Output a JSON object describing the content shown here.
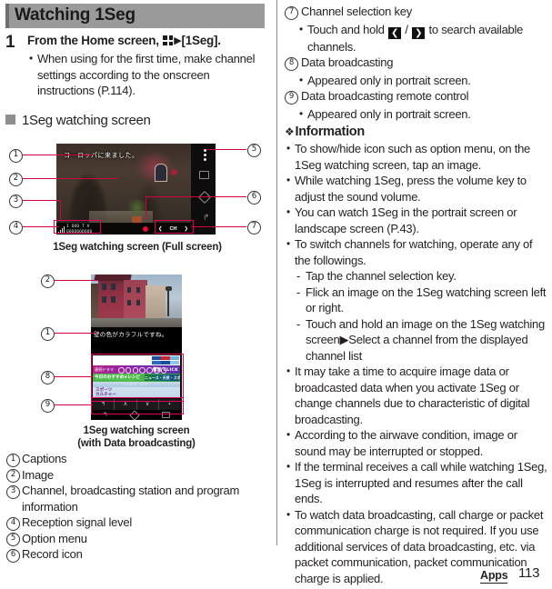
{
  "header": {
    "title": "Watching 1Seg"
  },
  "step": {
    "number": "1",
    "title_pre": "From the Home screen, ",
    "title_post": "[1Seg].",
    "bullets": [
      "When using for the first time, make channel settings according to the onscreen instructions (P.114)."
    ]
  },
  "subsection": {
    "title": "1Seg watching screen"
  },
  "figure_landscape": {
    "caption": "1Seg watching screen (Full screen)",
    "screen_caption_text": "ヨーロッパに来ました。",
    "channel_info_line1": "1 OOO T V",
    "channel_info_line2": "OOOOOOOOOO",
    "ch_label": "CH",
    "prev_arrow": "❮",
    "next_arrow": "❯",
    "callouts": [
      "1",
      "2",
      "3",
      "4",
      "5",
      "6",
      "7"
    ]
  },
  "figure_portrait": {
    "caption_line1": "1Seg watching screen",
    "caption_line2": "(with Data broadcasting)",
    "screen_caption_text": "壁の色がカラフルですね。",
    "data_row1_text": "連続ドラマ",
    "data_row1_right": "電話 CLICK",
    "data_row2_text": "今日のおすすめ★レシピ",
    "data_row2_tag": "ニュース・天気・スポーツ",
    "data_row3_text": "LINE UP",
    "data_list": [
      "スポーツ",
      "カルチャー"
    ],
    "remote_keys": [
      "↰",
      "∧",
      "∨",
      "▪"
    ],
    "callouts": [
      "1",
      "2",
      "8",
      "9"
    ]
  },
  "legend_left": [
    {
      "num": "1",
      "text": "Captions"
    },
    {
      "num": "2",
      "text": "Image"
    },
    {
      "num": "3",
      "text": "Channel, broadcasting station and program information"
    },
    {
      "num": "4",
      "text": "Reception signal level"
    },
    {
      "num": "5",
      "text": "Option menu"
    },
    {
      "num": "6",
      "text": "Record icon"
    }
  ],
  "legend_right": [
    {
      "num": "7",
      "text": "Channel selection key",
      "sub_pre": "Touch and hold ",
      "sub_key1": "❮",
      "sub_mid": " / ",
      "sub_key2": "❯",
      "sub_post": " to search available channels."
    },
    {
      "num": "8",
      "text": "Data broadcasting",
      "sub_plain": "Appeared only in portrait screen."
    },
    {
      "num": "9",
      "text": "Data broadcasting remote control",
      "sub_plain": "Appeared only in portrait screen."
    }
  ],
  "information": {
    "heading": "Information",
    "bullets": [
      {
        "text": "To show/hide icon such as option menu, on the 1Seg watching screen, tap an image."
      },
      {
        "text": "While watching 1Seg, press the volume key to adjust the sound volume."
      },
      {
        "text": "You can watch 1Seg in the portrait screen or landscape screen (P.43)."
      },
      {
        "text": "To switch channels for watching, operate any of the followings.",
        "dashes": [
          "Tap the channel selection key.",
          "Flick an image on the 1Seg watching screen left or right.",
          "Touch and hold an image on the 1Seg watching screen▶Select a channel from the displayed channel list"
        ]
      },
      {
        "text": "It may take a time to acquire image data or broadcasted data when you activate 1Seg or change channels due to characteristic of digital broadcasting."
      },
      {
        "text": "According to the airwave condition, image or sound may be interrupted or stopped."
      },
      {
        "text": "If the terminal receives a call while watching 1Seg, 1Seg is interrupted and resumes after the call ends."
      },
      {
        "text": "To watch data broadcasting, call charge or packet communication charge is not required. If you use additional services of data broadcasting, etc. via packet communication, packet communication charge is applied."
      }
    ]
  },
  "footer": {
    "section": "Apps",
    "page": "113"
  },
  "colors": {
    "accent_red": "#d4003c",
    "highlight_pink": "#e3005a",
    "header_gray": "#9a9a9a"
  }
}
